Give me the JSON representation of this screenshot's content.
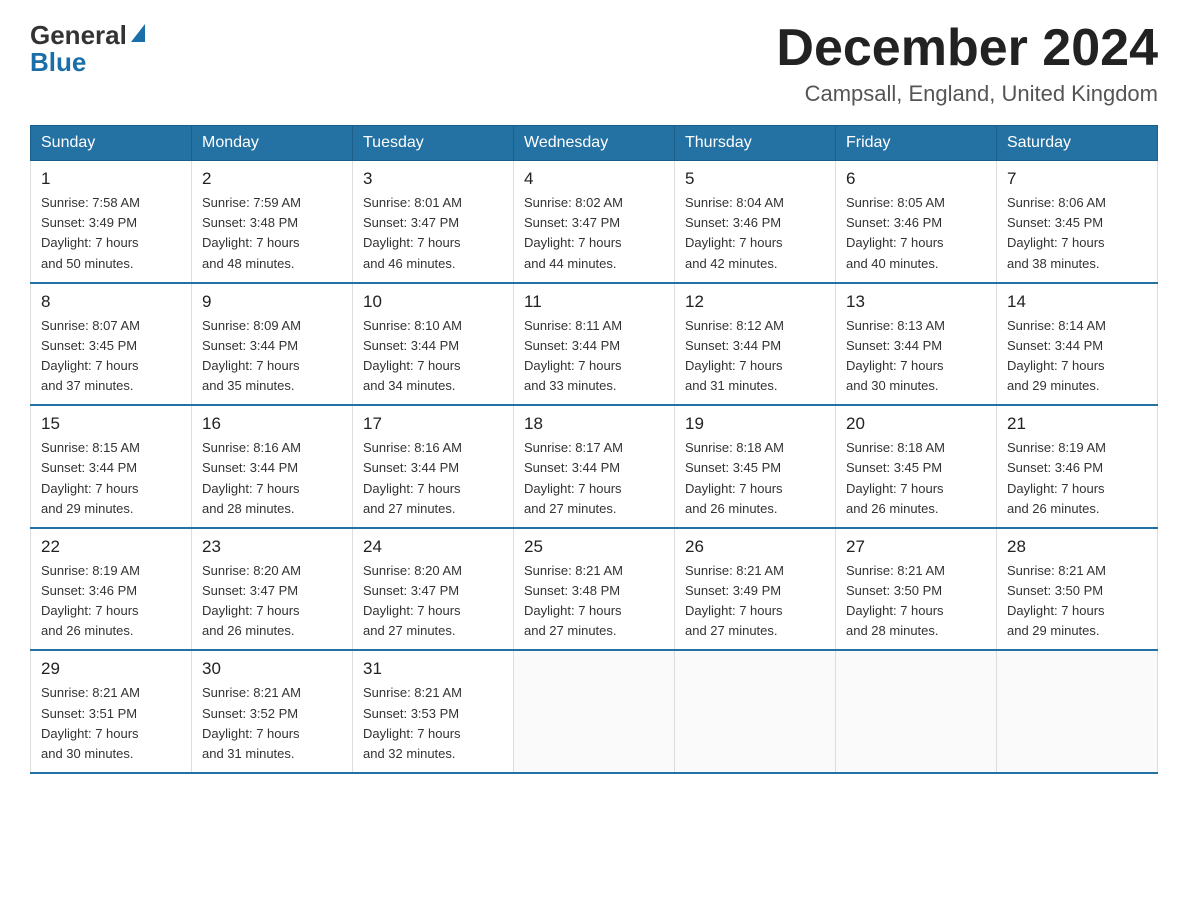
{
  "header": {
    "logo_general": "General",
    "logo_blue": "Blue",
    "month_title": "December 2024",
    "location": "Campsall, England, United Kingdom"
  },
  "days_of_week": [
    "Sunday",
    "Monday",
    "Tuesday",
    "Wednesday",
    "Thursday",
    "Friday",
    "Saturday"
  ],
  "weeks": [
    [
      {
        "day": "1",
        "sunrise": "7:58 AM",
        "sunset": "3:49 PM",
        "daylight": "7 hours and 50 minutes."
      },
      {
        "day": "2",
        "sunrise": "7:59 AM",
        "sunset": "3:48 PM",
        "daylight": "7 hours and 48 minutes."
      },
      {
        "day": "3",
        "sunrise": "8:01 AM",
        "sunset": "3:47 PM",
        "daylight": "7 hours and 46 minutes."
      },
      {
        "day": "4",
        "sunrise": "8:02 AM",
        "sunset": "3:47 PM",
        "daylight": "7 hours and 44 minutes."
      },
      {
        "day": "5",
        "sunrise": "8:04 AM",
        "sunset": "3:46 PM",
        "daylight": "7 hours and 42 minutes."
      },
      {
        "day": "6",
        "sunrise": "8:05 AM",
        "sunset": "3:46 PM",
        "daylight": "7 hours and 40 minutes."
      },
      {
        "day": "7",
        "sunrise": "8:06 AM",
        "sunset": "3:45 PM",
        "daylight": "7 hours and 38 minutes."
      }
    ],
    [
      {
        "day": "8",
        "sunrise": "8:07 AM",
        "sunset": "3:45 PM",
        "daylight": "7 hours and 37 minutes."
      },
      {
        "day": "9",
        "sunrise": "8:09 AM",
        "sunset": "3:44 PM",
        "daylight": "7 hours and 35 minutes."
      },
      {
        "day": "10",
        "sunrise": "8:10 AM",
        "sunset": "3:44 PM",
        "daylight": "7 hours and 34 minutes."
      },
      {
        "day": "11",
        "sunrise": "8:11 AM",
        "sunset": "3:44 PM",
        "daylight": "7 hours and 33 minutes."
      },
      {
        "day": "12",
        "sunrise": "8:12 AM",
        "sunset": "3:44 PM",
        "daylight": "7 hours and 31 minutes."
      },
      {
        "day": "13",
        "sunrise": "8:13 AM",
        "sunset": "3:44 PM",
        "daylight": "7 hours and 30 minutes."
      },
      {
        "day": "14",
        "sunrise": "8:14 AM",
        "sunset": "3:44 PM",
        "daylight": "7 hours and 29 minutes."
      }
    ],
    [
      {
        "day": "15",
        "sunrise": "8:15 AM",
        "sunset": "3:44 PM",
        "daylight": "7 hours and 29 minutes."
      },
      {
        "day": "16",
        "sunrise": "8:16 AM",
        "sunset": "3:44 PM",
        "daylight": "7 hours and 28 minutes."
      },
      {
        "day": "17",
        "sunrise": "8:16 AM",
        "sunset": "3:44 PM",
        "daylight": "7 hours and 27 minutes."
      },
      {
        "day": "18",
        "sunrise": "8:17 AM",
        "sunset": "3:44 PM",
        "daylight": "7 hours and 27 minutes."
      },
      {
        "day": "19",
        "sunrise": "8:18 AM",
        "sunset": "3:45 PM",
        "daylight": "7 hours and 26 minutes."
      },
      {
        "day": "20",
        "sunrise": "8:18 AM",
        "sunset": "3:45 PM",
        "daylight": "7 hours and 26 minutes."
      },
      {
        "day": "21",
        "sunrise": "8:19 AM",
        "sunset": "3:46 PM",
        "daylight": "7 hours and 26 minutes."
      }
    ],
    [
      {
        "day": "22",
        "sunrise": "8:19 AM",
        "sunset": "3:46 PM",
        "daylight": "7 hours and 26 minutes."
      },
      {
        "day": "23",
        "sunrise": "8:20 AM",
        "sunset": "3:47 PM",
        "daylight": "7 hours and 26 minutes."
      },
      {
        "day": "24",
        "sunrise": "8:20 AM",
        "sunset": "3:47 PM",
        "daylight": "7 hours and 27 minutes."
      },
      {
        "day": "25",
        "sunrise": "8:21 AM",
        "sunset": "3:48 PM",
        "daylight": "7 hours and 27 minutes."
      },
      {
        "day": "26",
        "sunrise": "8:21 AM",
        "sunset": "3:49 PM",
        "daylight": "7 hours and 27 minutes."
      },
      {
        "day": "27",
        "sunrise": "8:21 AM",
        "sunset": "3:50 PM",
        "daylight": "7 hours and 28 minutes."
      },
      {
        "day": "28",
        "sunrise": "8:21 AM",
        "sunset": "3:50 PM",
        "daylight": "7 hours and 29 minutes."
      }
    ],
    [
      {
        "day": "29",
        "sunrise": "8:21 AM",
        "sunset": "3:51 PM",
        "daylight": "7 hours and 30 minutes."
      },
      {
        "day": "30",
        "sunrise": "8:21 AM",
        "sunset": "3:52 PM",
        "daylight": "7 hours and 31 minutes."
      },
      {
        "day": "31",
        "sunrise": "8:21 AM",
        "sunset": "3:53 PM",
        "daylight": "7 hours and 32 minutes."
      },
      null,
      null,
      null,
      null
    ]
  ],
  "labels": {
    "sunrise": "Sunrise:",
    "sunset": "Sunset:",
    "daylight": "Daylight:"
  }
}
